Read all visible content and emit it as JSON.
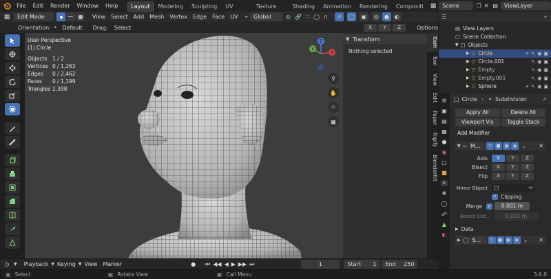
{
  "topbar": {
    "menus": [
      "File",
      "Edit",
      "Render",
      "Window",
      "Help"
    ],
    "workspaces": [
      "Layout",
      "Modeling",
      "Sculpting",
      "UV Editing",
      "Texture Paint",
      "Shading",
      "Animation",
      "Rendering",
      "Compositi"
    ],
    "active_workspace": "Layout",
    "scene": "Scene",
    "view_layer": "ViewLayer"
  },
  "viewport_header": {
    "mode": "Edit Mode",
    "menus": [
      "View",
      "Select",
      "Add",
      "Mesh",
      "Vertex",
      "Edge",
      "Face",
      "UV"
    ],
    "transform_orientation": "Global"
  },
  "tool_header": {
    "orientation_label": "Orientation:",
    "orientation_value": "Default",
    "drag_label": "Drag:",
    "drag_value": "Select La...",
    "axis": [
      "X",
      "Y",
      "Z"
    ],
    "options": "Options"
  },
  "overlay": {
    "perspective": "User Perspective",
    "object": "(1) Circle",
    "stats": [
      {
        "label": "Objects",
        "value": "1 / 2"
      },
      {
        "label": "Vertices",
        "value": "0 / 1,263"
      },
      {
        "label": "Edges",
        "value": "0 / 2,462"
      },
      {
        "label": "Faces",
        "value": "0 / 1,199"
      },
      {
        "label": "Triangles",
        "value": "2,398"
      }
    ]
  },
  "gizmo": {
    "z": "Z",
    "y": "Y",
    "x": "X"
  },
  "npanel": {
    "title": "Transform",
    "empty": "Nothing selected"
  },
  "side_tabs": [
    "Item",
    "Tool",
    "View",
    "Edit",
    "Paper",
    "Rigify",
    "BlenderKit"
  ],
  "outliner": {
    "rows": [
      {
        "label": "View Layers",
        "indent": 0
      },
      {
        "label": "Scene Collection",
        "indent": 0
      },
      {
        "label": "Objects",
        "indent": 1
      },
      {
        "label": "Circle",
        "indent": 2
      },
      {
        "label": "Circle.001",
        "indent": 2
      },
      {
        "label": "Empty",
        "indent": 2
      },
      {
        "label": "Empty.001",
        "indent": 2
      },
      {
        "label": "Sphere",
        "indent": 2
      }
    ]
  },
  "properties": {
    "object": "Circle",
    "context": "Subdivision",
    "apply_all": "Apply All",
    "delete_all": "Delete All",
    "viewport_vis": "Viewport Vis",
    "toggle_stack": "Toggle Stack",
    "add_modifier": "Add Modifier",
    "mirror_name": "M...",
    "axis_label": "Axis",
    "bisect_label": "Bisect",
    "flip_label": "Flip",
    "xyz": [
      "X",
      "Y",
      "Z"
    ],
    "mirror_object_label": "Mirror Object",
    "clipping": "Clipping",
    "merge_label": "Merge",
    "merge_value": "0.001 m",
    "bisect_dist_label": "Bisect Dist...",
    "bisect_dist_value": "0.001 m",
    "data_label": "Data",
    "subsurf_name": "S..."
  },
  "timeline": {
    "menus": [
      "Playback",
      "Keying",
      "View",
      "Marker"
    ],
    "current_frame": "1",
    "start_label": "Start",
    "start": "1",
    "end_label": "End",
    "end": "250"
  },
  "statusbar": {
    "select": "Select",
    "rotate": "Rotate View",
    "menu": "Call Menu",
    "version": "3.6.0"
  },
  "colors": {
    "accent": "#4772b3",
    "selected_row": "#334d80",
    "object_orange": "#e8a03c"
  }
}
